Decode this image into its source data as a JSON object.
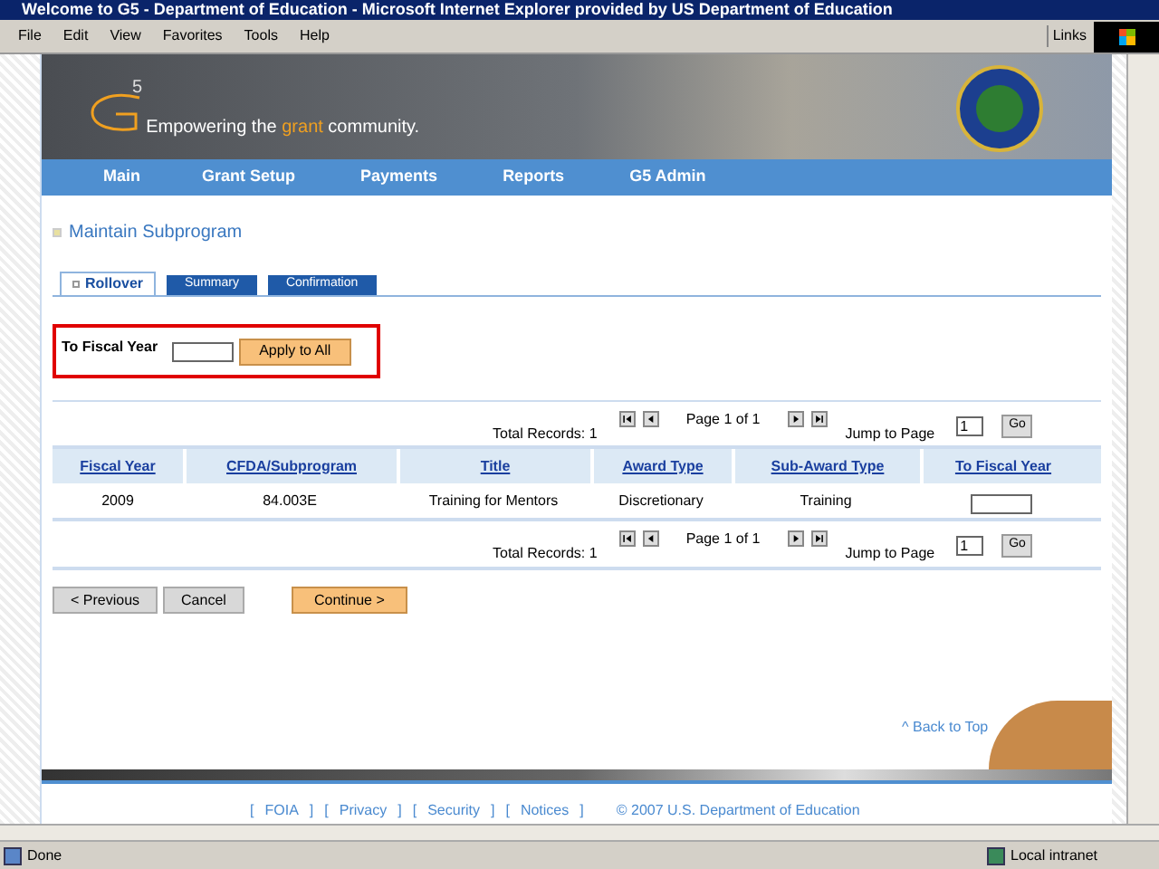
{
  "window": {
    "title": "Welcome to G5 - Department of Education - Microsoft Internet Explorer provided by US Department of Education"
  },
  "menu": [
    "File",
    "Edit",
    "View",
    "Favorites",
    "Tools",
    "Help"
  ],
  "links_label": "Links",
  "header": {
    "logo_mark": "5",
    "tagline_before": "Empowering the ",
    "tagline_highlight": "grant",
    "tagline_after": " community."
  },
  "nav": [
    "Main",
    "Grant Setup",
    "Payments",
    "Reports",
    "G5 Admin"
  ],
  "page_title": "Maintain Subprogram",
  "tabs": [
    {
      "label": "Rollover",
      "selected": true
    },
    {
      "label": "Summary",
      "selected": false
    },
    {
      "label": "Confirmation",
      "selected": false
    }
  ],
  "fiscal_form": {
    "label": "To Fiscal Year",
    "button": "Apply to All"
  },
  "pager_top": {
    "total": "Total Records: 1",
    "page": "Page 1 of 1",
    "jump_label": "Jump to Page",
    "jump_value": "1",
    "go": "Go"
  },
  "table": {
    "columns": [
      "Fiscal Year",
      "CFDA/Subprogram",
      "Title",
      "Award Type",
      "Sub-Award Type",
      "To Fiscal Year"
    ],
    "rows": [
      {
        "cells": [
          "2009",
          "84.003E",
          "Training for Mentors",
          "Discretionary",
          "Training"
        ]
      }
    ]
  },
  "pager_bottom": {
    "total": "Total Records: 1",
    "page": "Page 1 of 1",
    "jump_label": "Jump to Page",
    "jump_value": "1",
    "go": "Go"
  },
  "buttons": [
    {
      "label": "< Previous",
      "kind": "gray"
    },
    {
      "label": "Cancel",
      "kind": "gray"
    },
    {
      "label": "Continue >",
      "kind": "orange"
    }
  ],
  "back_to_top": "^ Back to Top",
  "footer": [
    {
      "kind": "bracket",
      "text": "["
    },
    {
      "kind": "link",
      "text": "FOIA"
    },
    {
      "kind": "bracket",
      "text": "]"
    },
    {
      "kind": "bracket",
      "text": "["
    },
    {
      "kind": "link",
      "text": "Privacy"
    },
    {
      "kind": "bracket",
      "text": "]"
    },
    {
      "kind": "bracket",
      "text": "["
    },
    {
      "kind": "link",
      "text": "Security"
    },
    {
      "kind": "bracket",
      "text": "]"
    },
    {
      "kind": "bracket",
      "text": "["
    },
    {
      "kind": "link",
      "text": "Notices"
    },
    {
      "kind": "bracket",
      "text": "]"
    },
    {
      "kind": "copyright",
      "text": "© 2007 U.S. Department of Education"
    }
  ],
  "status_bar": {
    "text": "Done",
    "zone": "Local intranet"
  }
}
